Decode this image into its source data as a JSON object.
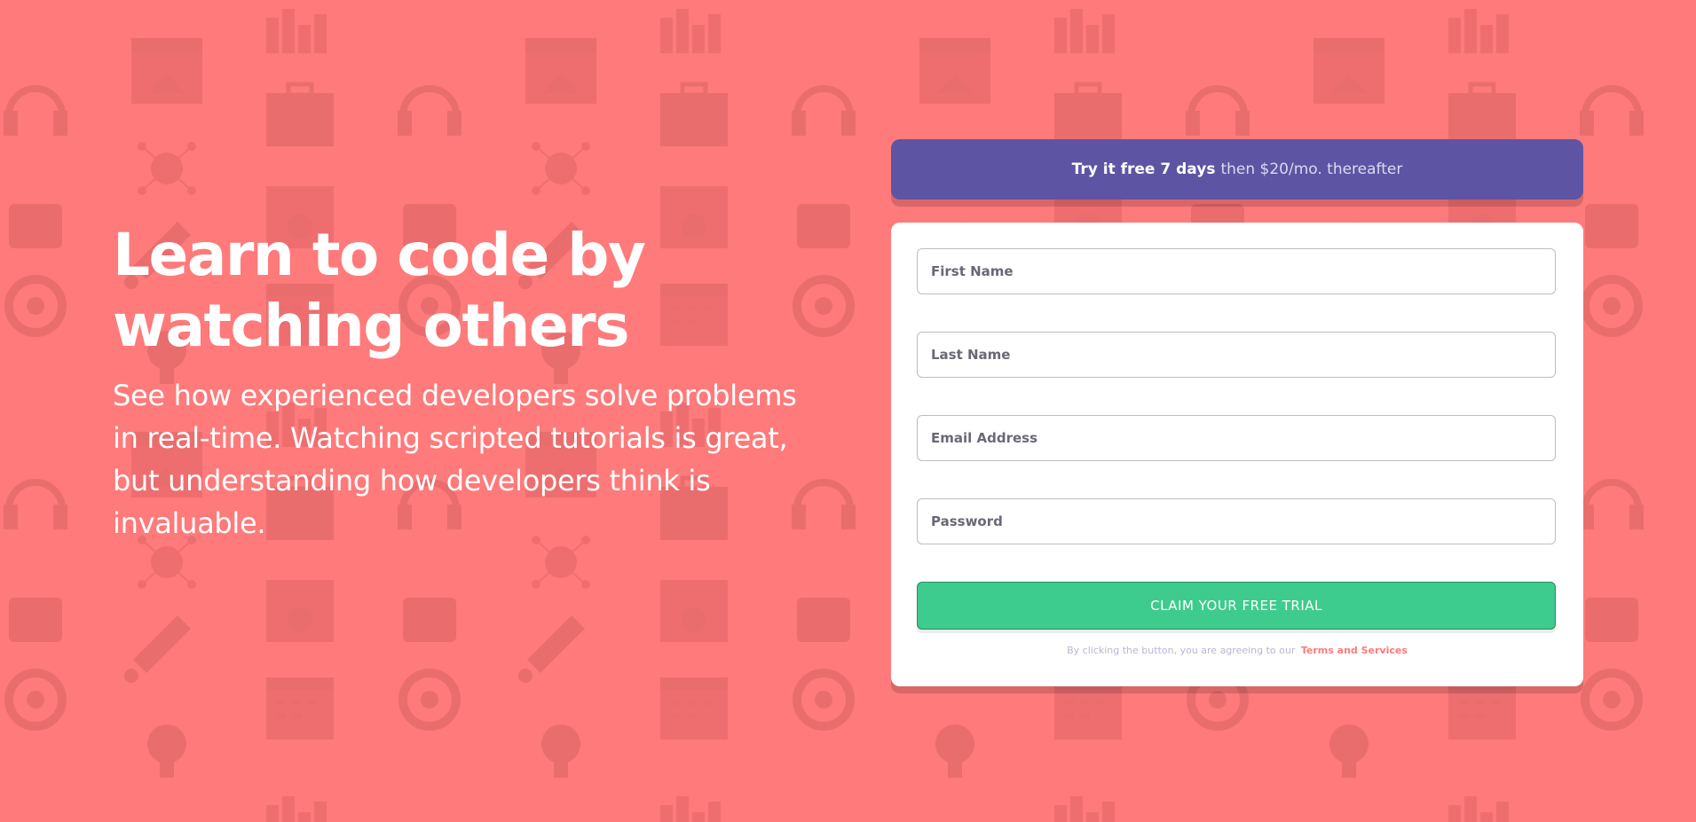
{
  "colors": {
    "background": "#ff7a7a",
    "banner": "#5e54a4",
    "button": "#3ecb8e",
    "link": "#ff7a7a",
    "text_dark": "#3d3b48"
  },
  "hero": {
    "title": "Learn to code by watching others",
    "description": "See how experienced developers solve problems in real-time. Watching scripted tutorials is great, but understanding how developers think is invaluable."
  },
  "banner": {
    "strong_text": "Try it free 7 days",
    "rest_text": "then $20/mo. thereafter"
  },
  "form": {
    "first_name_placeholder": "First Name",
    "last_name_placeholder": "Last Name",
    "email_placeholder": "Email Address",
    "password_placeholder": "Password",
    "submit_label": "CLAIM YOUR FREE TRIAL",
    "terms_text": "By clicking the button, you are agreeing to our",
    "terms_link": "Terms and Services"
  },
  "background_icons": [
    "headset-icon",
    "browser-window-icon",
    "bar-chart-icon",
    "toolbox-icon",
    "cloud-network-icon",
    "thumbs-up-icon",
    "rocket-icon",
    "gear-icon",
    "calendar-icon",
    "lightbulb-icon",
    "lifebuoy-icon"
  ]
}
